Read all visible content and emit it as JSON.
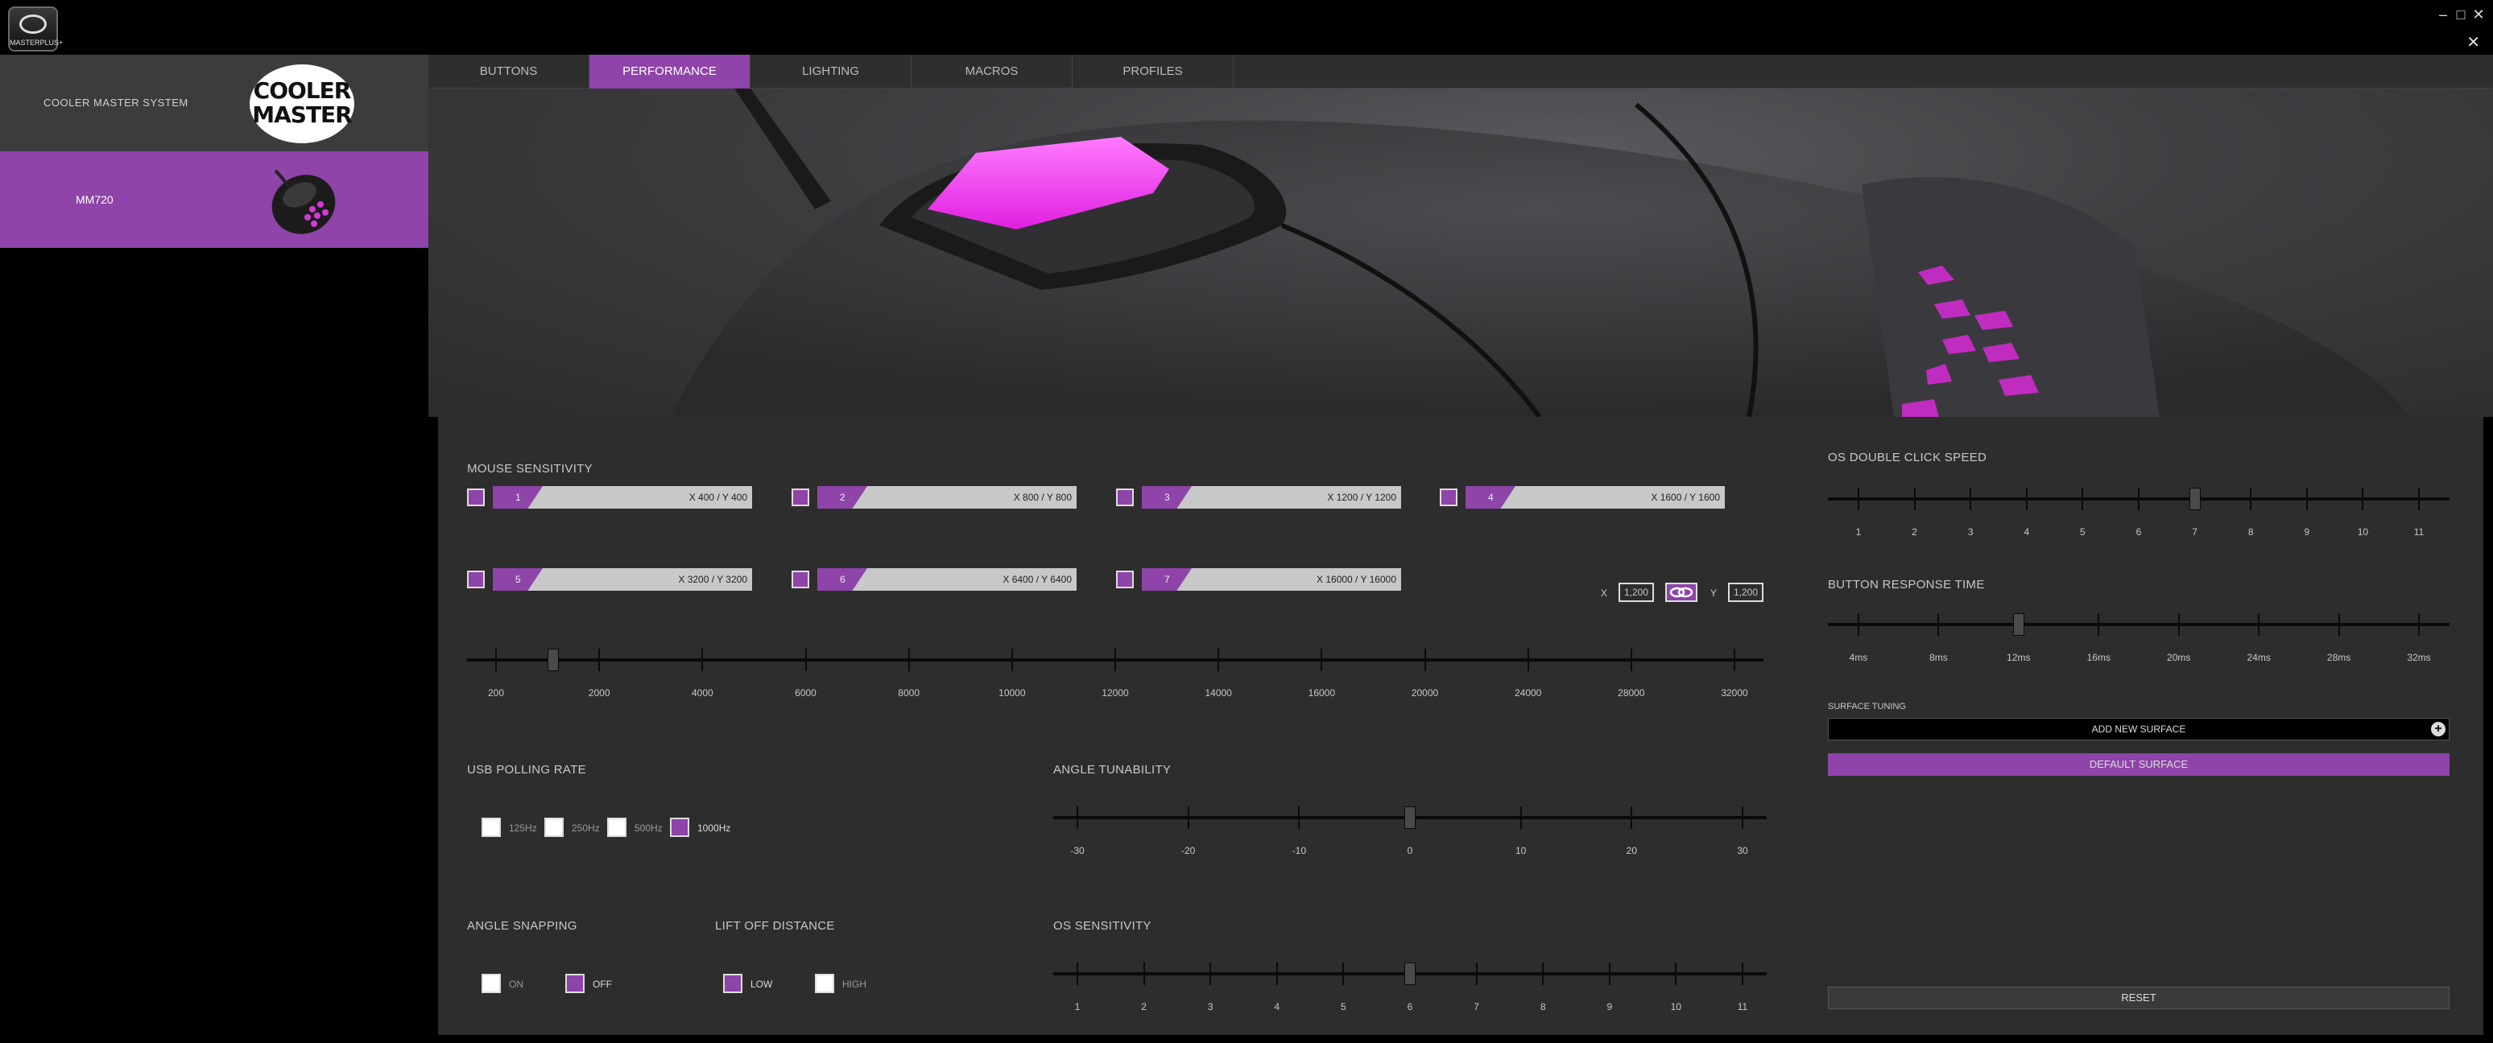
{
  "app": {
    "logo_text": "MASTERPLUS+"
  },
  "window": {
    "minimize": "–",
    "maximize": "□",
    "close": "✕",
    "panel_close": "✕"
  },
  "sidebar": {
    "system_label": "COOLER MASTER SYSTEM",
    "brand_logo_lines": [
      "COOLER",
      "MASTER"
    ],
    "device_label": "MM720"
  },
  "tabs": [
    {
      "label": "BUTTONS",
      "active": false
    },
    {
      "label": "PERFORMANCE",
      "active": true
    },
    {
      "label": "LIGHTING",
      "active": false
    },
    {
      "label": "MACROS",
      "active": false
    },
    {
      "label": "PROFILES",
      "active": false
    }
  ],
  "mouse_sensitivity": {
    "title": "MOUSE SENSITIVITY",
    "levels": [
      {
        "level": "1",
        "value": "X 400 / Y 400"
      },
      {
        "level": "2",
        "value": "X 800 / Y 800"
      },
      {
        "level": "3",
        "value": "X 1200 / Y 1200"
      },
      {
        "level": "4",
        "value": "X 1600 / Y 1600"
      },
      {
        "level": "5",
        "value": "X 3200 / Y 3200"
      },
      {
        "level": "6",
        "value": "X 6400 / Y 6400"
      },
      {
        "level": "7",
        "value": "X 16000 / Y 16000"
      }
    ],
    "x_label": "X",
    "x_value": "1,200",
    "y_label": "Y",
    "y_value": "1,200",
    "ticks": [
      "200",
      "2000",
      "4000",
      "6000",
      "8000",
      "10000",
      "12000",
      "14000",
      "16000",
      "20000",
      "24000",
      "28000",
      "32000"
    ],
    "slider_value": 1200
  },
  "usb_polling": {
    "title": "USB POLLING RATE",
    "options": [
      {
        "label": "125Hz",
        "selected": false
      },
      {
        "label": "250Hz",
        "selected": false
      },
      {
        "label": "500Hz",
        "selected": false
      },
      {
        "label": "1000Hz",
        "selected": true
      }
    ]
  },
  "angle_tunability": {
    "title": "ANGLE TUNABILITY",
    "ticks": [
      "-30",
      "-20",
      "-10",
      "0",
      "10",
      "20",
      "30"
    ],
    "value": 0
  },
  "angle_snapping": {
    "title": "ANGLE SNAPPING",
    "options": [
      {
        "label": "ON",
        "selected": false
      },
      {
        "label": "OFF",
        "selected": true
      }
    ]
  },
  "lift_off": {
    "title": "LIFT OFF DISTANCE",
    "options": [
      {
        "label": "LOW",
        "selected": true
      },
      {
        "label": "HIGH",
        "selected": false
      }
    ]
  },
  "os_sensitivity": {
    "title": "OS SENSITIVITY",
    "ticks": [
      "1",
      "2",
      "3",
      "4",
      "5",
      "6",
      "7",
      "8",
      "9",
      "10",
      "11"
    ],
    "value": 6
  },
  "os_double_click": {
    "title": "OS DOUBLE CLICK SPEED",
    "ticks": [
      "1",
      "2",
      "3",
      "4",
      "5",
      "6",
      "7",
      "8",
      "9",
      "10",
      "11"
    ],
    "value": 7
  },
  "button_response": {
    "title": "BUTTON RESPONSE TIME",
    "ticks": [
      "4ms",
      "8ms",
      "12ms",
      "16ms",
      "20ms",
      "24ms",
      "28ms",
      "32ms"
    ],
    "value": "12ms"
  },
  "surface_tuning": {
    "title": "SURFACE TUNING",
    "add_label": "ADD NEW SURFACE",
    "plus": "+",
    "default_label": "DEFAULT SURFACE"
  },
  "reset_label": "RESET",
  "colors": {
    "accent": "#8e44a8",
    "panel": "#2d2d2d",
    "highlight": "#ff2bff"
  }
}
